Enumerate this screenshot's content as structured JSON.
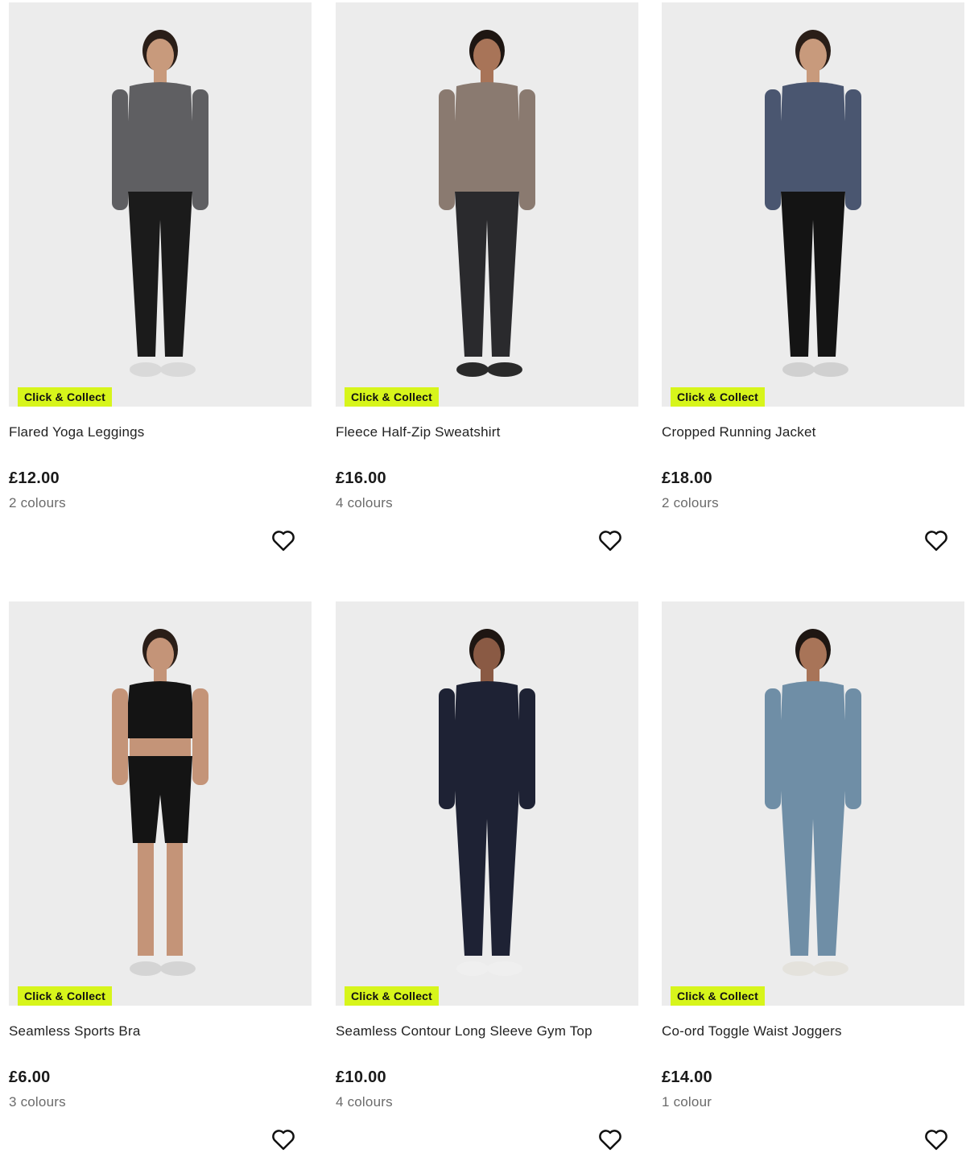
{
  "products": [
    {
      "badge": "Click & Collect",
      "name": "Flared Yoga Leggings",
      "price": "£12.00",
      "colours": "2 colours",
      "look": {
        "top": "#5f5f62",
        "bottom": "#1b1b1b",
        "hair": "#2a1e18",
        "skin": "#c89a7c",
        "shoe": "#d9d9d9"
      }
    },
    {
      "badge": "Click & Collect",
      "name": "Fleece Half-Zip Sweatshirt",
      "price": "£16.00",
      "colours": "4 colours",
      "look": {
        "top": "#8a7a70",
        "bottom": "#2a2a2d",
        "hair": "#1e1612",
        "skin": "#a87458",
        "shoe": "#2a2a2a"
      }
    },
    {
      "badge": "Click & Collect",
      "name": "Cropped Running Jacket",
      "price": "£18.00",
      "colours": "2 colours",
      "look": {
        "top": "#4a5670",
        "bottom": "#141414",
        "hair": "#2a1e18",
        "skin": "#c89a7c",
        "shoe": "#d0d0d0"
      }
    },
    {
      "badge": "Click & Collect",
      "name": "Seamless Sports Bra",
      "price": "£6.00",
      "colours": "3 colours",
      "look": {
        "top": "#141414",
        "bottom": "#141414",
        "hair": "#2a1e18",
        "skin": "#c49478",
        "shoe": "#d4d4d4"
      }
    },
    {
      "badge": "Click & Collect",
      "name": "Seamless Contour Long Sleeve Gym Top",
      "price": "£10.00",
      "colours": "4 colours",
      "look": {
        "top": "#1e2234",
        "bottom": "#1e2234",
        "hair": "#1e1612",
        "skin": "#8a5a44",
        "shoe": "#efefef"
      }
    },
    {
      "badge": "Click & Collect",
      "name": "Co-ord Toggle Waist Joggers",
      "price": "£14.00",
      "colours": "1 colour",
      "look": {
        "top": "#6f8ea6",
        "bottom": "#6f8ea6",
        "hair": "#1e1612",
        "skin": "#a87458",
        "shoe": "#e4e2dc"
      }
    }
  ],
  "icons": {
    "favourite": "heart-outline-icon"
  },
  "colors": {
    "badge_bg": "#d7f51b",
    "image_bg": "#ececec"
  }
}
